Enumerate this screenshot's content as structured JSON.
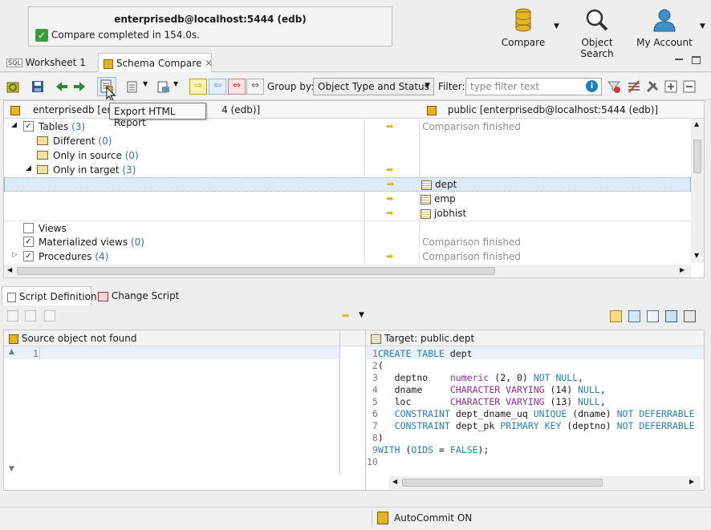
{
  "notification": {
    "connection": "enterprisedb@localhost:5444 (edb)",
    "message": "Compare completed in 154.0s."
  },
  "top_actions": {
    "compare": "Compare",
    "object_search": "Object Search",
    "my_account": "My Account"
  },
  "tabs": {
    "worksheet": "Worksheet 1",
    "schema_compare": "Schema Compare"
  },
  "toolbar": {
    "group_by_label": "Group by:",
    "group_by_value": "Object Type and Status",
    "filter_label": "Filter:",
    "filter_placeholder": "type filter text"
  },
  "tooltip": "Export HTML Report",
  "tree": {
    "left_header": "enterprisedb [enter",
    "left_header_tail": "4 (edb)]",
    "right_header": "public [enterprisedb@localhost:5444 (edb)]",
    "rows": {
      "tables": {
        "label": "Tables",
        "count": "(3)",
        "status": "Comparison finished"
      },
      "different": {
        "label": "Different",
        "count": "(0)"
      },
      "only_source": {
        "label": "Only in source",
        "count": "(0)"
      },
      "only_target": {
        "label": "Only in target",
        "count": "(3)"
      },
      "dept": "dept",
      "emp": "emp",
      "jobhist": "jobhist",
      "views": {
        "label": "Views"
      },
      "mat_views": {
        "label": "Materialized views",
        "count": "(0)",
        "status": "Comparison finished"
      },
      "procedures": {
        "label": "Procedures",
        "count": "(4)",
        "status": "Comparison finished"
      }
    }
  },
  "bottom_tabs": {
    "script_definition": "Script Definition",
    "change_script": "Change Script"
  },
  "source_pane": {
    "title": "Source object not found",
    "line1": "1"
  },
  "target_pane": {
    "title": "Target: public.dept",
    "lines": [
      {
        "n": "1",
        "text": "CREATE TABLE dept"
      },
      {
        "n": "2",
        "text": "("
      },
      {
        "n": "3",
        "text": "   deptno    numeric (2, 0) NOT NULL,"
      },
      {
        "n": "4",
        "text": "   dname     CHARACTER VARYING (14) NULL,"
      },
      {
        "n": "5",
        "text": "   loc       CHARACTER VARYING (13) NULL,"
      },
      {
        "n": "6",
        "text": "   CONSTRAINT dept_dname_uq UNIQUE (dname) NOT DEFERRABLE"
      },
      {
        "n": "7",
        "text": "   CONSTRAINT dept_pk PRIMARY KEY (deptno) NOT DEFERRABLE"
      },
      {
        "n": "8",
        "text": ")"
      },
      {
        "n": "9",
        "text": "WITH (OIDS = FALSE);"
      },
      {
        "n": "10",
        "text": ""
      }
    ]
  },
  "status": {
    "autocommit": "AutoCommit ON"
  }
}
